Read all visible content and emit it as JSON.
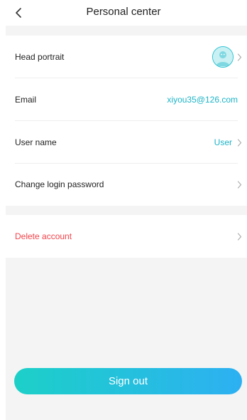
{
  "header": {
    "title": "Personal center",
    "back_icon": "chevron-left-icon"
  },
  "profile": {
    "head_portrait_label": "Head portrait",
    "email_label": "Email",
    "email_value": "xiyou35@126.com",
    "user_name_label": "User name",
    "user_name_value": "User",
    "change_password_label": "Change login password"
  },
  "danger": {
    "delete_account_label": "Delete account"
  },
  "actions": {
    "sign_out_label": "Sign out"
  },
  "colors": {
    "accent": "#1cb4c7",
    "danger": "#f2434a",
    "button_gradient_start": "#1cd0c8",
    "button_gradient_end": "#2db0f2",
    "page_background": "#f4f4f4"
  }
}
